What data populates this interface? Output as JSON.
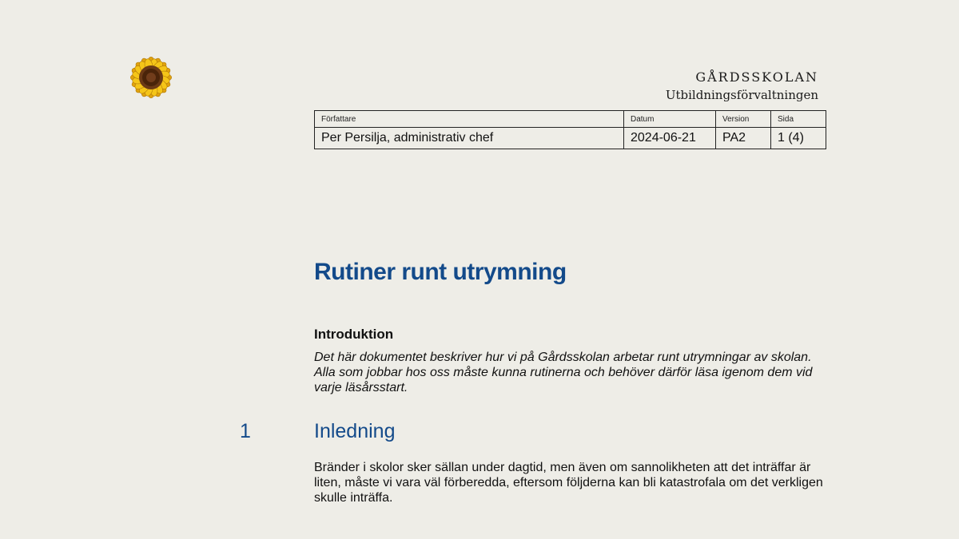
{
  "header": {
    "org_name": "GÅRDSSKOLAN",
    "org_department": "Utbildningsförvaltningen",
    "logo_icon": "sunflower-icon"
  },
  "meta_table": {
    "labels": {
      "author": "Författare",
      "date": "Datum",
      "version": "Version",
      "page": "Sida"
    },
    "values": {
      "author": "Per Persilja, administrativ chef",
      "date": "2024-06-21",
      "version": "PA2",
      "page": "1 (4)"
    }
  },
  "document": {
    "title": "Rutiner runt utrymning",
    "intro_heading": "Introduktion",
    "intro_text": "Det här dokumentet beskriver hur vi på Gårdsskolan arbetar runt utrymningar av skolan. Alla som jobbar hos oss måste kunna rutinerna och behöver därför läsa igenom dem vid varje läsårsstart.",
    "section_number": "1",
    "section_title": "Inledning",
    "section_text": "Bränder i skolor sker sällan under dagtid, men även om sannolikheten att det inträffar är liten, måste vi vara väl förberedda, eftersom följderna kan bli katastrofala om det verkligen skulle inträffa."
  },
  "colors": {
    "background": "#eeede7",
    "heading_blue": "#134a8a",
    "text": "#111111"
  }
}
